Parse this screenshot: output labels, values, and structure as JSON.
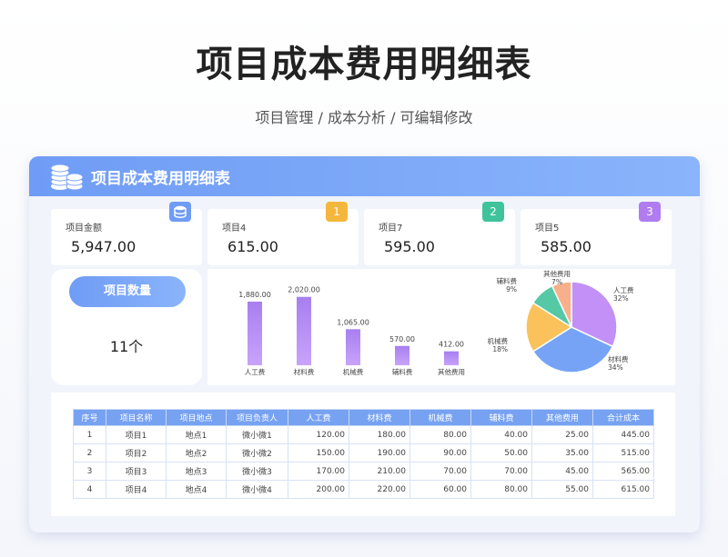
{
  "page": {
    "title": "项目成本费用明细表",
    "subtitle": "项目管理 / 成本分析 /  可编辑修改"
  },
  "card": {
    "title": "项目成本费用明细表",
    "icon": "coins-icon"
  },
  "kpis": [
    {
      "label": "项目金额",
      "value": "5,947.00",
      "badge": "",
      "badge_icon": "database-icon",
      "color": "#6f9cf5"
    },
    {
      "label": "项目4",
      "value": "615.00",
      "badge": "1",
      "color": "#f5b73b"
    },
    {
      "label": "项目7",
      "value": "595.00",
      "badge": "2",
      "color": "#3fc39a"
    },
    {
      "label": "项目5",
      "value": "585.00",
      "badge": "3",
      "color": "#b07cf0"
    }
  ],
  "count": {
    "label": "项目数量",
    "value": "11个"
  },
  "chart_data": [
    {
      "type": "bar",
      "categories": [
        "人工费",
        "材料费",
        "机械费",
        "辅料费",
        "其他费用"
      ],
      "values": [
        1880,
        2020,
        1065,
        570,
        412
      ],
      "data_labels": [
        "1,880.00",
        "2,020.00",
        "1,065.00",
        "570.00",
        "412.00"
      ],
      "ylim": [
        0,
        2200
      ],
      "colors": [
        "#a77ff0",
        "#c8a3fa"
      ]
    },
    {
      "type": "pie",
      "categories": [
        "人工费",
        "材料费",
        "机械费",
        "辅料费",
        "其他费用"
      ],
      "values": [
        32,
        34,
        18,
        9,
        7
      ],
      "percent_labels": [
        "32%",
        "34%",
        "18%",
        "9%",
        "7%"
      ],
      "colors": [
        "#c290f7",
        "#76a3f5",
        "#fbc15a",
        "#55c9a6",
        "#f7b08b"
      ]
    }
  ],
  "table": {
    "headers": [
      "序号",
      "项目名称",
      "项目地点",
      "项目负责人",
      "人工费",
      "材料费",
      "机械费",
      "辅料费",
      "其他费用",
      "合计成本"
    ],
    "rows": [
      [
        "1",
        "项目1",
        "地点1",
        "微小微1",
        "120.00",
        "180.00",
        "80.00",
        "40.00",
        "25.00",
        "445.00"
      ],
      [
        "2",
        "项目2",
        "地点2",
        "微小微2",
        "150.00",
        "190.00",
        "90.00",
        "50.00",
        "35.00",
        "515.00"
      ],
      [
        "3",
        "项目3",
        "地点3",
        "微小微3",
        "170.00",
        "210.00",
        "70.00",
        "70.00",
        "45.00",
        "565.00"
      ],
      [
        "4",
        "项目4",
        "地点4",
        "微小微4",
        "200.00",
        "220.00",
        "60.00",
        "80.00",
        "55.00",
        "615.00"
      ]
    ]
  }
}
